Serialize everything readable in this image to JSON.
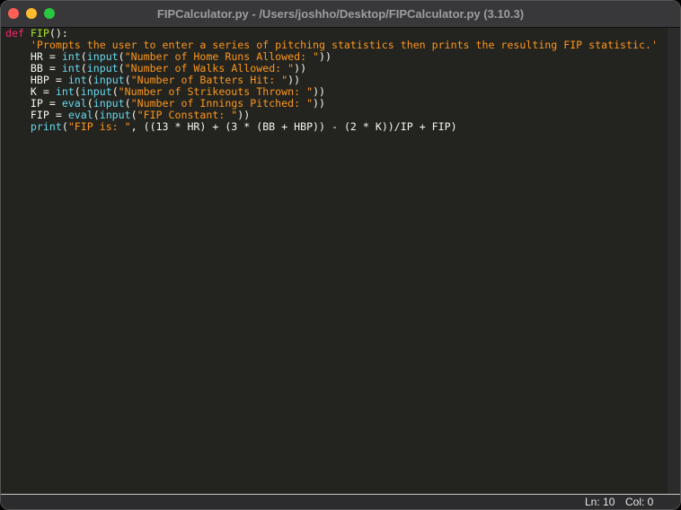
{
  "window": {
    "title": "FIPCalculator.py - /Users/joshho/Desktop/FIPCalculator.py (3.10.3)"
  },
  "code": [
    [
      [
        "kw",
        "def "
      ],
      [
        "fn",
        "FIP"
      ],
      [
        "pl",
        "():"
      ]
    ],
    [
      [
        "pl",
        "    "
      ],
      [
        "str",
        "'Prompts the user to enter a series of pitching statistics then prints the resulting FIP statistic.'"
      ]
    ],
    [
      [
        "pl",
        "    HR = "
      ],
      [
        "bi",
        "int"
      ],
      [
        "pl",
        "("
      ],
      [
        "bi",
        "input"
      ],
      [
        "pl",
        "("
      ],
      [
        "str",
        "\"Number of Home Runs Allowed: \""
      ],
      [
        "pl",
        "))"
      ]
    ],
    [
      [
        "pl",
        "    BB = "
      ],
      [
        "bi",
        "int"
      ],
      [
        "pl",
        "("
      ],
      [
        "bi",
        "input"
      ],
      [
        "pl",
        "("
      ],
      [
        "str",
        "\"Number of Walks Allowed: \""
      ],
      [
        "pl",
        "))"
      ]
    ],
    [
      [
        "pl",
        "    HBP = "
      ],
      [
        "bi",
        "int"
      ],
      [
        "pl",
        "("
      ],
      [
        "bi",
        "input"
      ],
      [
        "pl",
        "("
      ],
      [
        "str",
        "\"Number of Batters Hit: \""
      ],
      [
        "pl",
        "))"
      ]
    ],
    [
      [
        "pl",
        "    K = "
      ],
      [
        "bi",
        "int"
      ],
      [
        "pl",
        "("
      ],
      [
        "bi",
        "input"
      ],
      [
        "pl",
        "("
      ],
      [
        "str",
        "\"Number of Strikeouts Thrown: \""
      ],
      [
        "pl",
        "))"
      ]
    ],
    [
      [
        "pl",
        "    IP = "
      ],
      [
        "bi",
        "eval"
      ],
      [
        "pl",
        "("
      ],
      [
        "bi",
        "input"
      ],
      [
        "pl",
        "("
      ],
      [
        "str",
        "\"Number of Innings Pitched: \""
      ],
      [
        "pl",
        "))"
      ]
    ],
    [
      [
        "pl",
        "    FIP = "
      ],
      [
        "bi",
        "eval"
      ],
      [
        "pl",
        "("
      ],
      [
        "bi",
        "input"
      ],
      [
        "pl",
        "("
      ],
      [
        "str",
        "\"FIP Constant: \""
      ],
      [
        "pl",
        "))"
      ]
    ],
    [
      [
        "pl",
        "    "
      ],
      [
        "bi",
        "print"
      ],
      [
        "pl",
        "("
      ],
      [
        "str",
        "\"FIP is: \""
      ],
      [
        "pl",
        ", ((13 * HR) + (3 * (BB + HBP)) - (2 * K))/IP + FIP)"
      ]
    ]
  ],
  "status": {
    "line": "Ln: 10",
    "col": "Col: 0"
  }
}
